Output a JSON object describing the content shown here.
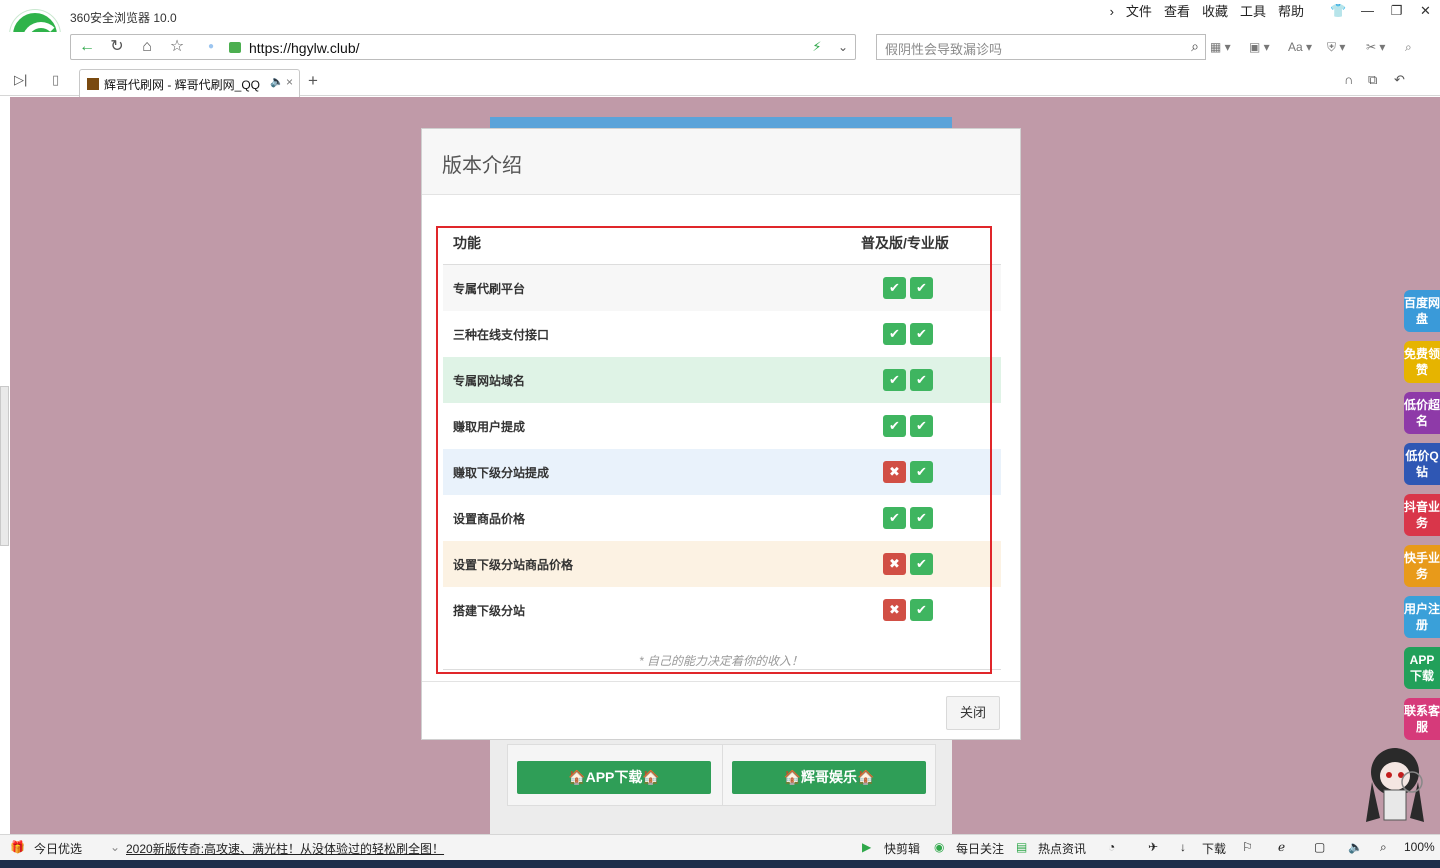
{
  "browser": {
    "app_title": "360安全浏览器 10.0",
    "menus": [
      "文件",
      "查看",
      "收藏",
      "工具",
      "帮助"
    ],
    "url": "https://hgylw.club/",
    "search_placeholder": "假阴性会导致漏诊吗",
    "tab_title": "辉哥代刷网 - 辉哥代刷网_QQ"
  },
  "modal": {
    "title": "版本介绍",
    "col_feature": "功能",
    "col_versions": "普及版/专业版",
    "note": "* 自己的能力决定着你的收入！",
    "close_label": "关闭",
    "rows": [
      {
        "label": "专属代刷平台",
        "basic": true,
        "pro": true
      },
      {
        "label": "三种在线支付接口",
        "basic": true,
        "pro": true
      },
      {
        "label": "专属网站域名",
        "basic": true,
        "pro": true
      },
      {
        "label": "赚取用户提成",
        "basic": true,
        "pro": true
      },
      {
        "label": "赚取下级分站提成",
        "basic": false,
        "pro": true
      },
      {
        "label": "设置商品价格",
        "basic": true,
        "pro": true
      },
      {
        "label": "设置下级分站商品价格",
        "basic": false,
        "pro": true
      },
      {
        "label": "搭建下级分站",
        "basic": false,
        "pro": true
      }
    ]
  },
  "site": {
    "app_download": "🏠APP下载🏠",
    "entertainment": "🏠辉哥娱乐🏠"
  },
  "floaters": [
    {
      "label": "百度网盘",
      "color": "#3a9ad9"
    },
    {
      "label": "免费领赞",
      "color": "#e6b400"
    },
    {
      "label": "低价超名",
      "color": "#8e3aa8"
    },
    {
      "label": "低价Q钻",
      "color": "#2f57b4"
    },
    {
      "label": "抖音业务",
      "color": "#d9364a"
    },
    {
      "label": "快手业务",
      "color": "#e89a1a"
    },
    {
      "label": "用户注册",
      "color": "#3aa0d9"
    },
    {
      "label": "APP下载",
      "color": "#22a05a"
    },
    {
      "label": "联系客服",
      "color": "#d63a7a"
    }
  ],
  "statusbar": {
    "today": "今日优选",
    "news": "2020新版传奇:高攻速、满光柱！从没体验过的轻松刷全图！",
    "quick_cut": "快剪辑",
    "daily": "每日关注",
    "hot": "热点资讯",
    "download": "下载",
    "zoom": "100%"
  }
}
